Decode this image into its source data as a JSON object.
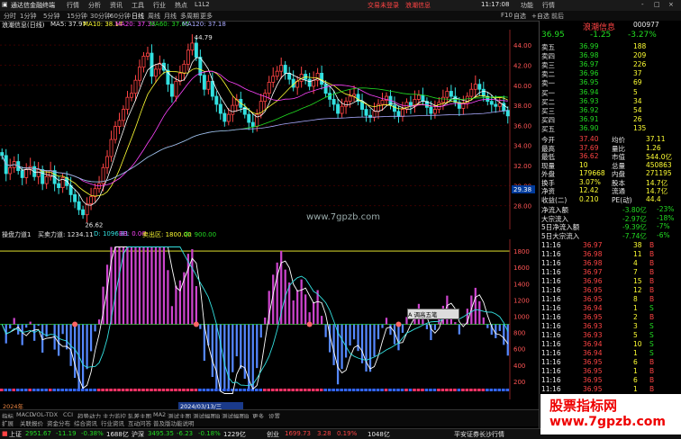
{
  "titlebar": {
    "app_name": "通达信金融终端",
    "menus": [
      "行情",
      "分析",
      "资讯",
      "工具",
      "行业",
      "热点",
      "L1L2"
    ],
    "notice1": "交易未登录",
    "notice2": "浪潮信息",
    "time": "11:17:08",
    "win_buttons": [
      "功能",
      "行情",
      "-",
      "□",
      "×"
    ]
  },
  "toolbar": {
    "periods": [
      "分时",
      "1分钟",
      "5分钟",
      "15分钟",
      "30分钟",
      "60分钟",
      "日线",
      "周线",
      "月线",
      "多周期",
      "更多"
    ],
    "right_items": [
      "F10",
      "自选",
      "+自选",
      "前后"
    ],
    "active_period": "日线"
  },
  "infobar": {
    "title": "浪潮信息(日线)",
    "ma5": "MA5: 37.97",
    "ma10": "MA10: 38.14",
    "ma20": "MA20: 37.33",
    "ma60": "MA60: 37.65",
    "ma120": "MA120: 37.18"
  },
  "price_axis": [
    "44.00",
    "42.00",
    "40.00",
    "38.00",
    "36.00",
    "34.00",
    "32.00",
    "30.00",
    "28.00"
  ],
  "price_annotations": {
    "high": "44.79",
    "low": "26.62",
    "cur": "29.38"
  },
  "site_text": "www.7gpzb.com",
  "indicator_info": {
    "name": "操盘力道1",
    "buy": "买卖力道: 1234.11",
    "d": "D: 1096.81",
    "bb": "BB: 0.00",
    "sell": "卖出区: 1800.00",
    "z": "中: 900.00"
  },
  "indicator_axis": [
    "1800",
    "1600",
    "1400",
    "1200",
    "1000",
    "800",
    "600",
    "400",
    "200"
  ],
  "date_bar": {
    "left": "2024年",
    "mid": "2024/03/13/三",
    "marks": [
      "2",
      "3",
      "4",
      "5",
      "6",
      "7"
    ]
  },
  "popup": "A 调高五笔",
  "tabs": [
    "指标",
    "MACD",
    "VOL-TDX",
    "CCI",
    "趋势动力",
    "主力监控",
    "轧差主图",
    "MA2",
    "测试主图",
    "测试幅图B",
    "测试幅图B",
    "更多",
    "设置"
  ],
  "tabs2": [
    "扩展",
    "关联报价",
    "资金分布",
    "综合资讯",
    "行业资讯",
    "互动问答",
    "普及版功能说明"
  ],
  "statusbar": {
    "sh_label": "上证",
    "sh_val": "2951.67",
    "sh_chg": "-11.19",
    "sh_pct": "-0.38%",
    "sh_amt": "1688亿",
    "sz_label": "沪深",
    "sz_val": "3495.35",
    "sz_chg": "-6.23",
    "sz_pct": "-0.18%",
    "sz_amt": "1229亿",
    "cy_label": "创业",
    "cy_val": "1699.73",
    "cy_chg": "3.28",
    "cy_pct": "0.19%",
    "cy_amt": "1048亿",
    "broker": "平安证券长沙行情"
  },
  "quote": {
    "name": "浪潮信息",
    "code": "000977",
    "price": "36.95",
    "change": "-1.25",
    "pct": "-3.27%",
    "asks": [
      {
        "label": "卖五",
        "price": "36.99",
        "vol": "188"
      },
      {
        "label": "卖四",
        "price": "36.98",
        "vol": "209"
      },
      {
        "label": "卖三",
        "price": "36.97",
        "vol": "226"
      },
      {
        "label": "卖二",
        "price": "36.96",
        "vol": "37"
      },
      {
        "label": "卖一",
        "price": "36.95",
        "vol": "69"
      }
    ],
    "bids": [
      {
        "label": "买一",
        "price": "36.94",
        "vol": "5"
      },
      {
        "label": "买二",
        "price": "36.93",
        "vol": "34"
      },
      {
        "label": "买三",
        "price": "36.92",
        "vol": "54"
      },
      {
        "label": "买四",
        "price": "36.91",
        "vol": "26"
      },
      {
        "label": "买五",
        "price": "36.90",
        "vol": "135"
      }
    ],
    "stats": [
      {
        "l1": "今开",
        "v1": "37.40",
        "l2": "均价",
        "v2": "37.11"
      },
      {
        "l1": "最高",
        "v1": "37.69",
        "l2": "量比",
        "v2": "1.26"
      },
      {
        "l1": "最低",
        "v1": "36.62",
        "l2": "市值",
        "v2": "544.0亿"
      },
      {
        "l1": "现量",
        "v1": "10",
        "l2": "总量",
        "v2": "450863"
      },
      {
        "l1": "外盘",
        "v1": "179668",
        "l2": "内盘",
        "v2": "271195"
      },
      {
        "l1": "换手",
        "v1": "3.07%",
        "l2": "股本",
        "v2": "14.7亿"
      },
      {
        "l1": "净资",
        "v1": "12.42",
        "l2": "流通",
        "v2": "14.7亿"
      },
      {
        "l1": "收益(二)",
        "v1": "0.210",
        "l2": "PE(动)",
        "v2": "44.4"
      }
    ],
    "flows": [
      {
        "label": "净流入额",
        "val": "-3.80亿",
        "pct": "-23%"
      },
      {
        "label": "大宗流入",
        "val": "-2.97亿",
        "pct": "-18%"
      },
      {
        "label": "5日净流入额",
        "val": "-9.39亿",
        "pct": "-7%"
      },
      {
        "label": "5日大宗流入",
        "val": "-7.74亿",
        "pct": "-6%"
      }
    ],
    "ticks": [
      {
        "t": "11:16",
        "p": "36.97",
        "v": "38",
        "s": "B"
      },
      {
        "t": "11:16",
        "p": "36.98",
        "v": "11",
        "s": "B"
      },
      {
        "t": "11:16",
        "p": "36.98",
        "v": "4",
        "s": "B"
      },
      {
        "t": "11:16",
        "p": "36.97",
        "v": "7",
        "s": "B"
      },
      {
        "t": "11:16",
        "p": "36.96",
        "v": "15",
        "s": "B"
      },
      {
        "t": "11:16",
        "p": "36.95",
        "v": "12",
        "s": "B"
      },
      {
        "t": "11:16",
        "p": "36.95",
        "v": "8",
        "s": "B"
      },
      {
        "t": "11:16",
        "p": "36.94",
        "v": "1",
        "s": "S"
      },
      {
        "t": "11:16",
        "p": "36.95",
        "v": "2",
        "s": "B"
      },
      {
        "t": "11:16",
        "p": "36.93",
        "v": "3",
        "s": "S"
      },
      {
        "t": "11:16",
        "p": "36.93",
        "v": "5",
        "s": "S"
      },
      {
        "t": "11:16",
        "p": "36.94",
        "v": "10",
        "s": "S"
      },
      {
        "t": "11:16",
        "p": "36.94",
        "v": "1",
        "s": "S"
      },
      {
        "t": "11:16",
        "p": "36.95",
        "v": "6",
        "s": "B"
      },
      {
        "t": "11:16",
        "p": "36.95",
        "v": "1",
        "s": "B"
      },
      {
        "t": "11:16",
        "p": "36.95",
        "v": "6",
        "s": "B"
      },
      {
        "t": "11:16",
        "p": "36.95",
        "v": "1",
        "s": "B"
      },
      {
        "t": "11:16",
        "p": "36.95",
        "v": "6",
        "s": "B"
      }
    ],
    "bottom": "图文F10 标准"
  },
  "watermark": {
    "line1": "股票指标网",
    "line2": "www.7gpzb.com"
  },
  "colors": {
    "up": "#ff4444",
    "down": "#22dd22",
    "bg": "#000000",
    "grid": "#3a0000"
  },
  "chart_data": {
    "type": "candlestick",
    "closes": [
      33.0,
      31.2,
      31.8,
      32.4,
      31.5,
      30.8,
      31.6,
      31.9,
      30.9,
      31.6,
      30.2,
      30.9,
      31.5,
      30.2,
      29.8,
      30.8,
      30.0,
      29.1,
      28.4,
      27.6,
      27.1,
      28.2,
      28.9,
      29.7,
      30.2,
      31.8,
      32.9,
      34.6,
      35.9,
      36.5,
      37.6,
      38.8,
      39.2,
      40.5,
      41.8,
      42.9,
      43.2,
      40.9,
      41.6,
      42.2,
      41.5,
      40.1,
      38.9,
      40.4,
      41.2,
      42.1,
      43.5,
      44.2,
      42.8,
      41.0,
      39.6,
      40.4,
      38.9,
      38.1,
      37.2,
      36.4,
      37.1,
      38.0,
      38.6,
      37.8,
      37.1,
      36.3,
      35.9,
      37.1,
      38.4,
      39.2,
      40.3,
      40.9,
      41.4,
      42.0,
      41.2,
      40.6,
      39.8,
      40.4,
      41.1,
      40.6,
      39.9,
      40.5,
      41.2,
      40.1,
      39.2,
      38.6,
      38.1,
      37.2,
      37.9,
      38.4,
      38.9,
      39.1,
      38.4,
      37.6,
      37.0,
      36.8,
      37.4,
      38.1,
      38.5,
      38.9,
      38.0,
      37.4,
      36.9,
      37.6,
      38.3,
      37.9,
      38.6,
      39.0,
      38.4,
      37.8,
      37.2,
      37.6,
      38.3,
      38.8,
      39.4,
      38.9,
      38.3,
      37.7,
      38.2,
      38.9,
      39.6,
      40.1,
      39.6,
      38.9,
      38.4,
      38.1,
      37.9,
      38.2,
      37.5,
      36.95
    ],
    "ylim": [
      26,
      45
    ]
  }
}
